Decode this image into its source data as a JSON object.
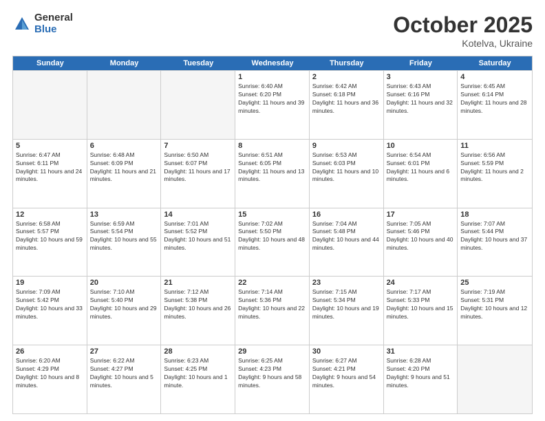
{
  "logo": {
    "general": "General",
    "blue": "Blue"
  },
  "header": {
    "month": "October 2025",
    "location": "Kotelva, Ukraine"
  },
  "weekdays": [
    "Sunday",
    "Monday",
    "Tuesday",
    "Wednesday",
    "Thursday",
    "Friday",
    "Saturday"
  ],
  "rows": [
    [
      {
        "day": "",
        "empty": true
      },
      {
        "day": "",
        "empty": true
      },
      {
        "day": "",
        "empty": true
      },
      {
        "day": "1",
        "sunrise": "Sunrise: 6:40 AM",
        "sunset": "Sunset: 6:20 PM",
        "daylight": "Daylight: 11 hours and 39 minutes."
      },
      {
        "day": "2",
        "sunrise": "Sunrise: 6:42 AM",
        "sunset": "Sunset: 6:18 PM",
        "daylight": "Daylight: 11 hours and 36 minutes."
      },
      {
        "day": "3",
        "sunrise": "Sunrise: 6:43 AM",
        "sunset": "Sunset: 6:16 PM",
        "daylight": "Daylight: 11 hours and 32 minutes."
      },
      {
        "day": "4",
        "sunrise": "Sunrise: 6:45 AM",
        "sunset": "Sunset: 6:14 PM",
        "daylight": "Daylight: 11 hours and 28 minutes."
      }
    ],
    [
      {
        "day": "5",
        "sunrise": "Sunrise: 6:47 AM",
        "sunset": "Sunset: 6:11 PM",
        "daylight": "Daylight: 11 hours and 24 minutes."
      },
      {
        "day": "6",
        "sunrise": "Sunrise: 6:48 AM",
        "sunset": "Sunset: 6:09 PM",
        "daylight": "Daylight: 11 hours and 21 minutes."
      },
      {
        "day": "7",
        "sunrise": "Sunrise: 6:50 AM",
        "sunset": "Sunset: 6:07 PM",
        "daylight": "Daylight: 11 hours and 17 minutes."
      },
      {
        "day": "8",
        "sunrise": "Sunrise: 6:51 AM",
        "sunset": "Sunset: 6:05 PM",
        "daylight": "Daylight: 11 hours and 13 minutes."
      },
      {
        "day": "9",
        "sunrise": "Sunrise: 6:53 AM",
        "sunset": "Sunset: 6:03 PM",
        "daylight": "Daylight: 11 hours and 10 minutes."
      },
      {
        "day": "10",
        "sunrise": "Sunrise: 6:54 AM",
        "sunset": "Sunset: 6:01 PM",
        "daylight": "Daylight: 11 hours and 6 minutes."
      },
      {
        "day": "11",
        "sunrise": "Sunrise: 6:56 AM",
        "sunset": "Sunset: 5:59 PM",
        "daylight": "Daylight: 11 hours and 2 minutes."
      }
    ],
    [
      {
        "day": "12",
        "sunrise": "Sunrise: 6:58 AM",
        "sunset": "Sunset: 5:57 PM",
        "daylight": "Daylight: 10 hours and 59 minutes."
      },
      {
        "day": "13",
        "sunrise": "Sunrise: 6:59 AM",
        "sunset": "Sunset: 5:54 PM",
        "daylight": "Daylight: 10 hours and 55 minutes."
      },
      {
        "day": "14",
        "sunrise": "Sunrise: 7:01 AM",
        "sunset": "Sunset: 5:52 PM",
        "daylight": "Daylight: 10 hours and 51 minutes."
      },
      {
        "day": "15",
        "sunrise": "Sunrise: 7:02 AM",
        "sunset": "Sunset: 5:50 PM",
        "daylight": "Daylight: 10 hours and 48 minutes."
      },
      {
        "day": "16",
        "sunrise": "Sunrise: 7:04 AM",
        "sunset": "Sunset: 5:48 PM",
        "daylight": "Daylight: 10 hours and 44 minutes."
      },
      {
        "day": "17",
        "sunrise": "Sunrise: 7:05 AM",
        "sunset": "Sunset: 5:46 PM",
        "daylight": "Daylight: 10 hours and 40 minutes."
      },
      {
        "day": "18",
        "sunrise": "Sunrise: 7:07 AM",
        "sunset": "Sunset: 5:44 PM",
        "daylight": "Daylight: 10 hours and 37 minutes."
      }
    ],
    [
      {
        "day": "19",
        "sunrise": "Sunrise: 7:09 AM",
        "sunset": "Sunset: 5:42 PM",
        "daylight": "Daylight: 10 hours and 33 minutes."
      },
      {
        "day": "20",
        "sunrise": "Sunrise: 7:10 AM",
        "sunset": "Sunset: 5:40 PM",
        "daylight": "Daylight: 10 hours and 29 minutes."
      },
      {
        "day": "21",
        "sunrise": "Sunrise: 7:12 AM",
        "sunset": "Sunset: 5:38 PM",
        "daylight": "Daylight: 10 hours and 26 minutes."
      },
      {
        "day": "22",
        "sunrise": "Sunrise: 7:14 AM",
        "sunset": "Sunset: 5:36 PM",
        "daylight": "Daylight: 10 hours and 22 minutes."
      },
      {
        "day": "23",
        "sunrise": "Sunrise: 7:15 AM",
        "sunset": "Sunset: 5:34 PM",
        "daylight": "Daylight: 10 hours and 19 minutes."
      },
      {
        "day": "24",
        "sunrise": "Sunrise: 7:17 AM",
        "sunset": "Sunset: 5:33 PM",
        "daylight": "Daylight: 10 hours and 15 minutes."
      },
      {
        "day": "25",
        "sunrise": "Sunrise: 7:19 AM",
        "sunset": "Sunset: 5:31 PM",
        "daylight": "Daylight: 10 hours and 12 minutes."
      }
    ],
    [
      {
        "day": "26",
        "sunrise": "Sunrise: 6:20 AM",
        "sunset": "Sunset: 4:29 PM",
        "daylight": "Daylight: 10 hours and 8 minutes."
      },
      {
        "day": "27",
        "sunrise": "Sunrise: 6:22 AM",
        "sunset": "Sunset: 4:27 PM",
        "daylight": "Daylight: 10 hours and 5 minutes."
      },
      {
        "day": "28",
        "sunrise": "Sunrise: 6:23 AM",
        "sunset": "Sunset: 4:25 PM",
        "daylight": "Daylight: 10 hours and 1 minute."
      },
      {
        "day": "29",
        "sunrise": "Sunrise: 6:25 AM",
        "sunset": "Sunset: 4:23 PM",
        "daylight": "Daylight: 9 hours and 58 minutes."
      },
      {
        "day": "30",
        "sunrise": "Sunrise: 6:27 AM",
        "sunset": "Sunset: 4:21 PM",
        "daylight": "Daylight: 9 hours and 54 minutes."
      },
      {
        "day": "31",
        "sunrise": "Sunrise: 6:28 AM",
        "sunset": "Sunset: 4:20 PM",
        "daylight": "Daylight: 9 hours and 51 minutes."
      },
      {
        "day": "",
        "empty": true
      }
    ]
  ]
}
